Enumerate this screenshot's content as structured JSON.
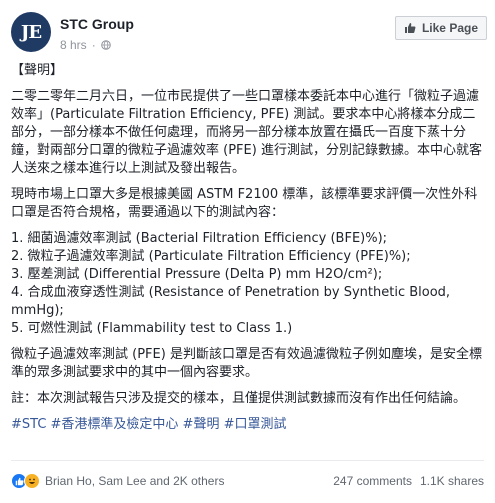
{
  "header": {
    "page_name": "STC Group",
    "avatar_text": "JE",
    "time": "8 hrs",
    "like_page_label": "Like Page"
  },
  "post": {
    "heading": "【聲明】",
    "para1": "二零二零年二月六日，一位市民提供了一些口罩樣本委託本中心進行「微粒子過濾效率」(Particulate Filtration Efficiency, PFE) 測試。要求本中心將樣本分成二部分，一部分樣本不做任何處理，而將另一部分樣本放置在攝氏一百度下蒸十分鐘，對兩部分口罩的微粒子過濾效率 (PFE) 進行測試，分別記錄數據。本中心就客人送來之樣本進行以上測試及發出報告。",
    "para2": "現時市場上口罩大多是根據美國 ASTM F2100 標準，該標準要求評價一次性外科口罩是否符合規格，需要通過以下的測試內容：",
    "list": [
      "1. 細菌過濾效率測試 (Bacterial Filtration Efficiency (BFE)%);",
      "2. 微粒子過濾效率測試 (Particulate Filtration Efficiency (PFE)%);",
      "3. 壓差測試 (Differential Pressure (Delta P) mm H2O/cm²);",
      "4. 合成血液穿透性測試 (Resistance of Penetration by Synthetic Blood, mmHg);",
      "5. 可燃性測試 (Flammability test to Class 1.)"
    ],
    "para3": "微粒子過濾效率測試 (PFE) 是判斷該口罩是否有效過濾微粒子例如塵埃，是安全標準的眾多測試要求中的其中一個內容要求。",
    "para4": "註：本次測試報告只涉及提交的樣本，且僅提供測試數據而沒有作出任何結論。",
    "hashtags": "#STC #香港標準及檢定中心 #聲明 #口罩測試"
  },
  "footer": {
    "reactors": "Brian Ho, Sam Lee and 2K others",
    "comments": "247 comments",
    "shares": "1.1K shares"
  },
  "colors": {
    "avatar_bg": "#1f3b64",
    "link": "#385898",
    "like_blue": "#1877f2",
    "haha_yellow": "#f7b125"
  },
  "icons": [
    "globe-icon",
    "like-thumb-icon",
    "like-reaction-icon",
    "haha-reaction-icon"
  ]
}
